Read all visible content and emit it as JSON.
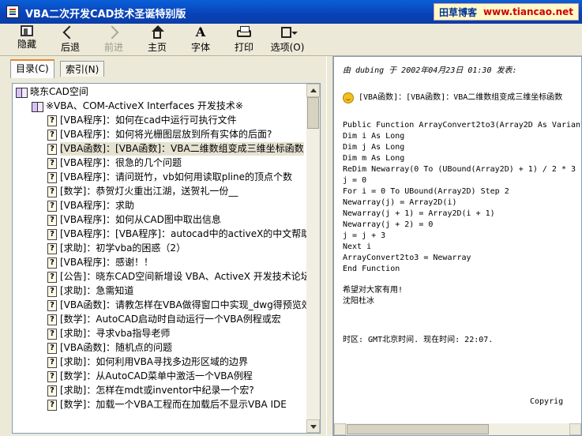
{
  "window": {
    "title": "VBA二次开发CAD技术圣诞特别版",
    "blog_name": "田草博客",
    "blog_url": "www.tiancao.net"
  },
  "toolbar": {
    "hide_label": "隐藏",
    "back_label": "后退",
    "forward_label": "前进",
    "home_label": "主页",
    "font_label": "字体",
    "font_glyph": "A",
    "print_label": "打印",
    "options_label": "选项(O)",
    "forward_disabled": true
  },
  "tabs": {
    "contents": "目录(C)",
    "index": "索引(N)",
    "active": "contents"
  },
  "tree": {
    "root": "晓东CAD空间",
    "folder": "※VBA、COM-ActiveX Interfaces 开发技术※",
    "topic_glyph": "?",
    "items": [
      "[VBA程序]：如何在cad中运行可执行文件",
      "[VBA程序]：如何将光栅图层放到所有实体的后面?",
      "[VBA函数]：[VBA函数]：VBA二维数组变成三维坐标函数",
      "[VBA程序]：很急的几个问题",
      "[VBA程序]：请问斑竹，vb如何用读取pline的顶点个数",
      "[数学]：恭贺灯火重出江湖，送贺礼一份__",
      "[VBA程序]：求助",
      "[VBA程序]：如何从CAD图中取出信息",
      "[VBA程序]：[VBA程序]：autocad中的activeX的中文帮助",
      "[求助]：初学vba的困惑（2）",
      "[VBA程序]：感谢！！",
      "[公告]：晓东CAD空间新增设 VBA、ActiveX 开发技术论坛，",
      "[求助]：急需知道",
      "[VBA函数]：请教怎样在VBA做得窗口中实现_dwg得预览效",
      "[数学]：AutoCAD启动时自动运行一个VBA例程或宏",
      "[求助]：寻求vba指导老师",
      "[VBA函数]：随机点的问题",
      "[求助]：如何利用VBA寻找多边形区域的边界",
      "[数学]：从AutoCAD菜单中激活一个VBA例程",
      "[求助]：怎样在mdt或inventor中纪录一个宏?",
      "[数学]：加载一个VBA工程而在加载后不显示VBA IDE"
    ],
    "selected_index": 2
  },
  "content": {
    "meta": "由 dubing 于 2002年04月23日 01:30 发表:",
    "subject": "[VBA函数]：[VBA函数]：VBA二维数组变成三维坐标函数",
    "code": [
      "Public Function ArrayConvert2to3(Array2D As Variant",
      "Dim i As Long",
      "Dim j As Long",
      "Dim m As Long",
      "ReDim Newarray(0 To (UBound(Array2D) + 1) / 2 * 3 -",
      "j = 0",
      "For i = 0 To UBound(Array2D) Step 2",
      "Newarray(j) = Array2D(i)",
      "Newarray(j + 1) = Array2D(i + 1)",
      "Newarray(j + 2) = 0",
      "j = j + 3",
      "Next i",
      "ArrayConvert2to3 = Newarray",
      "End Function"
    ],
    "closing": "希望对大家有用!",
    "signature": "沈阳杜冰",
    "timezone": "时区: GMT北京时间. 现在时间: 22:07.",
    "copyright": "Copyrig"
  }
}
